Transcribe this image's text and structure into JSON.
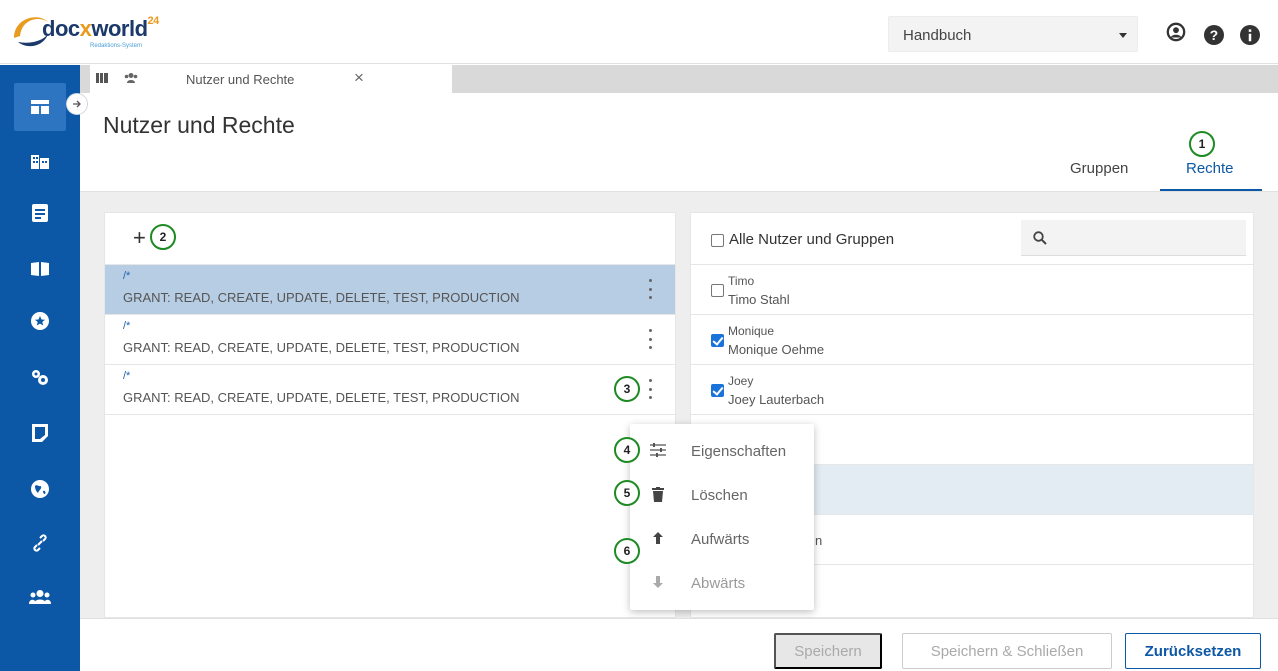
{
  "header": {
    "logo_text": "docxworld",
    "logo_x": "x",
    "logo_sup": "24",
    "logo_tagline": "Redaktions-System",
    "handbook_select": "Handbuch"
  },
  "tabstrip": {
    "tab_label": "Nutzer und Rechte",
    "close": "×"
  },
  "page": {
    "title": "Nutzer und Rechte",
    "tabs": [
      {
        "label": "Gruppen"
      },
      {
        "label": "Rechte"
      }
    ]
  },
  "rules": {
    "add": "+",
    "items": [
      {
        "path": "/*",
        "grant": "GRANT: READ, CREATE, UPDATE, DELETE, TEST, PRODUCTION"
      },
      {
        "path": "/*",
        "grant": "GRANT: READ, CREATE, UPDATE, DELETE, TEST, PRODUCTION"
      },
      {
        "path": "/*",
        "grant": "GRANT: READ, CREATE, UPDATE, DELETE, TEST, PRODUCTION"
      }
    ]
  },
  "users_panel": {
    "all_label": "Alle Nutzer und Gruppen",
    "search_placeholder": "",
    "users": [
      {
        "nick": "Timo",
        "full": "Timo Stahl",
        "checked": false
      },
      {
        "nick": "Monique",
        "full": "Monique Oehme",
        "checked": true
      },
      {
        "nick": "Joey",
        "full": "Joey Lauterbach",
        "checked": true
      }
    ],
    "partial_text": "n"
  },
  "context_menu": {
    "items": [
      {
        "label": "Eigenschaften",
        "icon": "sliders-icon",
        "enabled": true
      },
      {
        "label": "Löschen",
        "icon": "trash-icon",
        "enabled": true
      },
      {
        "label": "Aufwärts",
        "icon": "arrow-up-icon",
        "enabled": true
      },
      {
        "label": "Abwärts",
        "icon": "arrow-down-icon",
        "enabled": false
      }
    ]
  },
  "annotations": [
    "1",
    "2",
    "3",
    "4",
    "5",
    "6"
  ],
  "footer": {
    "save": "Speichern",
    "save_close": "Speichern & Schließen",
    "reset": "Zurücksetzen"
  },
  "colors": {
    "primary": "#0d58a6",
    "sidebar_active": "#2d74c1",
    "selected_row": "#b7cde3",
    "annotation": "#1d8a23"
  }
}
